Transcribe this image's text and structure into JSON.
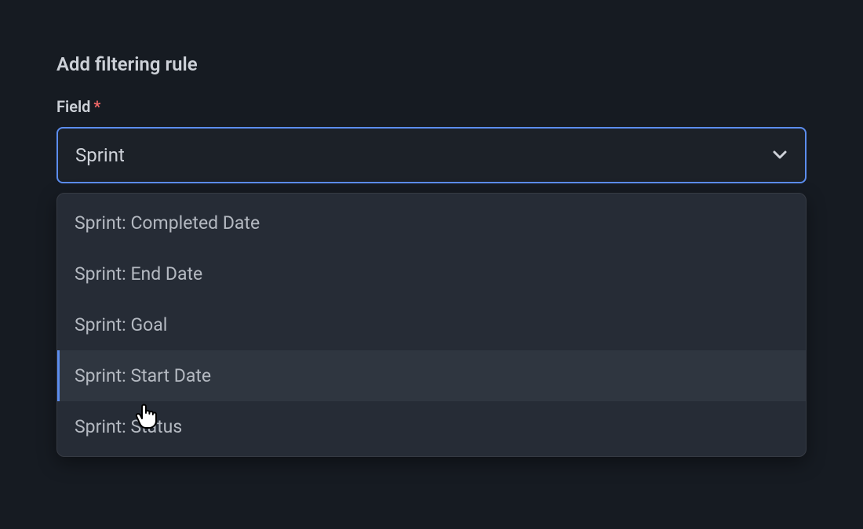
{
  "section": {
    "title": "Add filtering rule"
  },
  "field": {
    "label": "Field",
    "required_marker": "*",
    "selected": "Sprint"
  },
  "dropdown": {
    "items": [
      {
        "label": "Sprint: Completed Date",
        "highlighted": false
      },
      {
        "label": "Sprint: End Date",
        "highlighted": false
      },
      {
        "label": "Sprint: Goal",
        "highlighted": false
      },
      {
        "label": "Sprint: Start Date",
        "highlighted": true
      },
      {
        "label": "Sprint: Status",
        "highlighted": false
      }
    ]
  }
}
